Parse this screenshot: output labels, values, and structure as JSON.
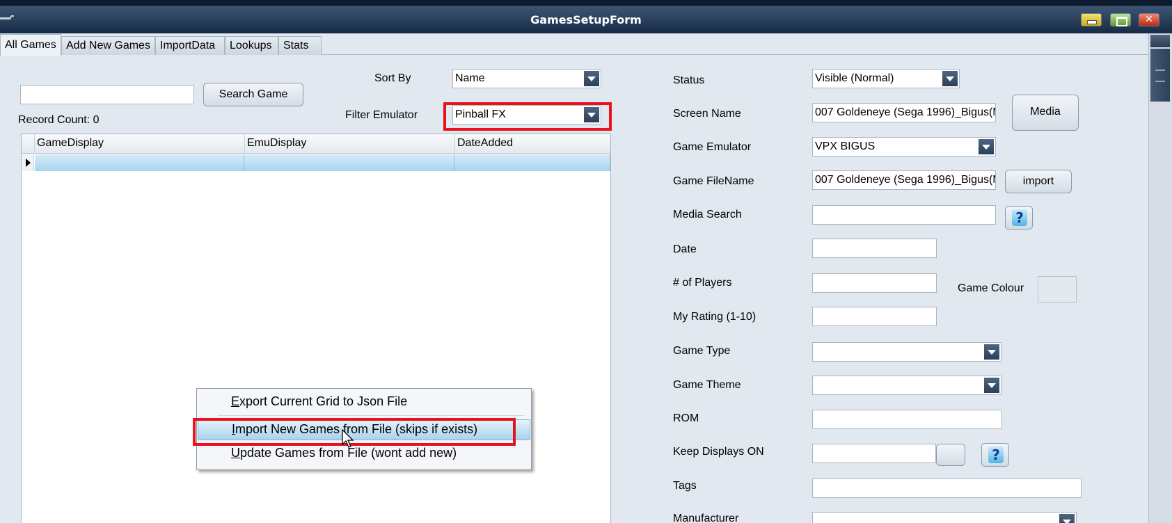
{
  "window": {
    "title": "GamesSetupForm"
  },
  "tabs": [
    {
      "label": "All Games",
      "active": true
    },
    {
      "label": "Add New Games",
      "active": false
    },
    {
      "label": "ImportData",
      "active": false
    },
    {
      "label": "Lookups",
      "active": false
    },
    {
      "label": "Stats",
      "active": false
    }
  ],
  "search": {
    "value": "",
    "button_label": "Search Game",
    "record_count": "Record Count: 0"
  },
  "sort": {
    "label": "Sort By",
    "value": "Name"
  },
  "filter": {
    "label": "Filter Emulator",
    "value": "Pinball FX"
  },
  "grid": {
    "columns": [
      "GameDisplay",
      "EmuDisplay",
      "DateAdded"
    ],
    "rows": [
      [
        "",
        "",
        ""
      ]
    ]
  },
  "context_menu": {
    "items": [
      {
        "label": "Export Current Grid to Json File",
        "accel": "E",
        "rest": "xport Current Grid to Json File"
      },
      {
        "label": "Import New Games from File (skips if exists)",
        "accel": "I",
        "rest": "mport New Games from File (skips if exists)",
        "highlighted": true
      },
      {
        "label": "Update Games from File (wont add new)",
        "accel": "U",
        "rest": "pdate Games from File (wont add new)"
      }
    ]
  },
  "form": {
    "status": {
      "label": "Status",
      "value": "Visible (Normal)"
    },
    "screen_name": {
      "label": "Screen Name",
      "value": "007 Goldeneye (Sega 1996)_Bigus(M",
      "button": "Media"
    },
    "game_emulator": {
      "label": "Game Emulator",
      "value": "VPX BIGUS"
    },
    "game_filename": {
      "label": "Game FileName",
      "value": "007 Goldeneye (Sega 1996)_Bigus(M",
      "button": "import"
    },
    "media_search": {
      "label": "Media Search",
      "value": "",
      "help": "?"
    },
    "date": {
      "label": "Date",
      "value": ""
    },
    "players": {
      "label": "# of  Players",
      "value": ""
    },
    "game_colour": {
      "label": "Game Colour"
    },
    "rating": {
      "label": "My Rating (1-10)",
      "value": ""
    },
    "game_type": {
      "label": "Game Type",
      "value": ""
    },
    "game_theme": {
      "label": "Game Theme",
      "value": ""
    },
    "rom": {
      "label": "ROM",
      "value": ""
    },
    "keep_displays": {
      "label": "Keep Displays ON",
      "value": "",
      "help": "?"
    },
    "tags": {
      "label": "Tags",
      "value": ""
    },
    "manufacturer": {
      "label": "Manufacturer",
      "value": ""
    }
  }
}
